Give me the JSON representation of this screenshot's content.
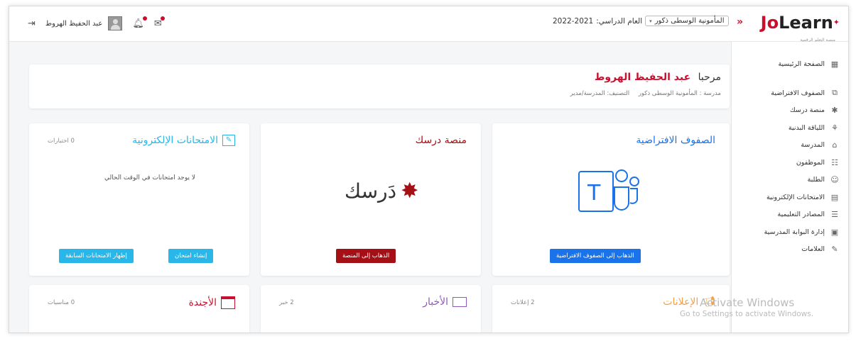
{
  "header": {
    "logo_jo": "Jo",
    "logo_learn": "Learn",
    "logo_tagline": "منصة التعلم الرقمية",
    "collapse": "»",
    "school_select": "المأمونية الوسطى ذكور",
    "year_label": "العام الدراسي:",
    "year_value": "2022-2021",
    "user_name": "عبد الحفيظ الهروط"
  },
  "sidebar": {
    "items": [
      {
        "label": "الصفحة الرئيسية",
        "icon": "home-grid-icon",
        "glyph": "▦"
      },
      {
        "label": "الصفوف الافتراضية",
        "icon": "teams-icon",
        "glyph": "⧉"
      },
      {
        "label": "منصة درسك",
        "icon": "darsak-icon",
        "glyph": "✱"
      },
      {
        "label": "اللياقة البدنية",
        "icon": "fitness-icon",
        "glyph": "⚘"
      },
      {
        "label": "المدرسة",
        "icon": "school-icon",
        "glyph": "⌂"
      },
      {
        "label": "الموظفون",
        "icon": "staff-icon",
        "glyph": "☷"
      },
      {
        "label": "الطلبة",
        "icon": "students-icon",
        "glyph": "☺"
      },
      {
        "label": "الامتحانات الإلكترونية",
        "icon": "exam-icon",
        "glyph": "▤"
      },
      {
        "label": "المصادر التعليمية",
        "icon": "resources-icon",
        "glyph": "☰"
      },
      {
        "label": "إدارة البوابة المدرسية",
        "icon": "portal-icon",
        "glyph": "▣"
      },
      {
        "label": "العلامات",
        "icon": "grades-icon",
        "glyph": "✎"
      }
    ]
  },
  "welcome": {
    "greeting": "مرحبا",
    "name": "عبد الحفيظ الهروط",
    "school_text": "مدرسة : المأمونية الوسطى ذكور",
    "role_text": "التصنيف: المدرسة/مدير"
  },
  "cards": {
    "virtual": {
      "title": "الصفوف الافتراضية",
      "button": "الذهاب إلى الصفوف الافتراضية",
      "color": "#1a73e8"
    },
    "darsak": {
      "title": "منصة درسك",
      "logo_text": "دَرسك",
      "button": "الذهاب إلى المنصة",
      "color": "#a50f16"
    },
    "exams": {
      "title": "الامتحانات الإلكترونية",
      "count": "0 اختبارات",
      "empty": "لا يوجد امتحانات في الوقت الحالي",
      "btn_create": "إنشاء امتحان",
      "btn_previous": "إظهار الامتحانات السابقة",
      "color": "#29b6e8"
    },
    "ads": {
      "title": "الإعلانات",
      "count": "2 إعلانات",
      "color": "#f4a04a"
    },
    "news": {
      "title": "الأخبار",
      "count": "2 خبر",
      "color": "#8e5ab5"
    },
    "agenda": {
      "title": "الأجندة",
      "count": "0 مناسبات",
      "color": "#c8102e"
    }
  },
  "watermark": {
    "line1": "Activate Windows",
    "line2": "Go to Settings to activate Windows."
  }
}
